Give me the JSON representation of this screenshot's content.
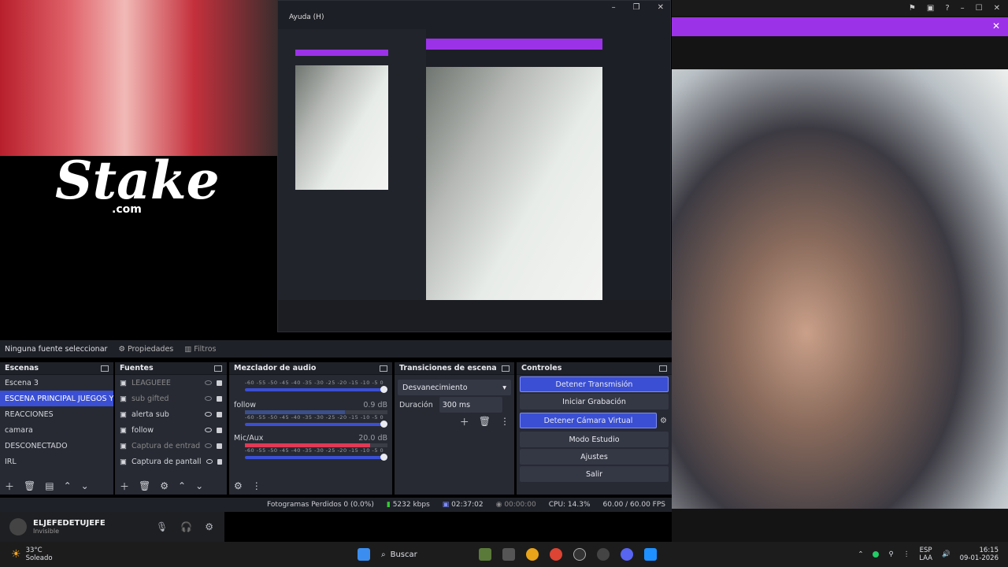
{
  "menu": {
    "help": "Ayuda (H)"
  },
  "brand": {
    "logo": "Stake",
    "domain": ".com"
  },
  "tabs": {
    "properties": "Propiedades",
    "filters": "Filtros",
    "no_source": "Ninguna fuente seleccionar"
  },
  "scenes": {
    "title": "Escenas",
    "items": [
      "Escena 3",
      "ESCENA PRINCIPAL JUEGOS Y REA",
      "REACCIONES",
      "camara",
      "DESCONECTADO",
      "IRL"
    ],
    "selected_index": 1
  },
  "sources": {
    "title": "Fuentes",
    "items": [
      {
        "name": "LEAGUEEE",
        "visible": false
      },
      {
        "name": "sub gifted",
        "visible": false
      },
      {
        "name": "alerta sub",
        "visible": true
      },
      {
        "name": "follow",
        "visible": true
      },
      {
        "name": "Captura de entrad",
        "visible": false
      },
      {
        "name": "Captura de pantall",
        "visible": true
      }
    ]
  },
  "mixer": {
    "title": "Mezclador de audio",
    "scale": "-60 -55 -50 -45 -40 -35 -30 -25 -20 -15 -10 -5 0",
    "channels": [
      {
        "name": "",
        "db": ""
      },
      {
        "name": "follow",
        "db": "0.9 dB"
      },
      {
        "name": "Mic/Aux",
        "db": "20.0 dB"
      }
    ]
  },
  "transitions": {
    "title": "Transiciones de escena",
    "selected": "Desvanecimiento",
    "duration_label": "Duración",
    "duration_value": "300 ms"
  },
  "controls": {
    "title": "Controles",
    "buttons": [
      "Detener Transmisión",
      "Iniciar Grabación",
      "Detener Cámara Virtual",
      "Modo Estudio",
      "Ajustes",
      "Salir"
    ]
  },
  "statusbar": {
    "dropped": "Fotogramas Perdidos 0 (0.0%)",
    "bitrate": "5232 kbps",
    "live": "02:37:02",
    "rec": "00:00:00",
    "cpu": "CPU: 14.3%",
    "fps": "60.00 / 60.00 FPS"
  },
  "discord": {
    "username": "ELJEFEDETUJEFE",
    "status": "Invisible"
  },
  "taskbar": {
    "temp": "33°C",
    "weather": "Soleado",
    "search": "Buscar",
    "lang": "ESP",
    "lang2": "LAA",
    "time": "16:15",
    "date": "09-01-2026"
  },
  "colors": {
    "accent": "#3a4fd4",
    "purple": "#9b32e8",
    "live_red": "#e03a55"
  }
}
